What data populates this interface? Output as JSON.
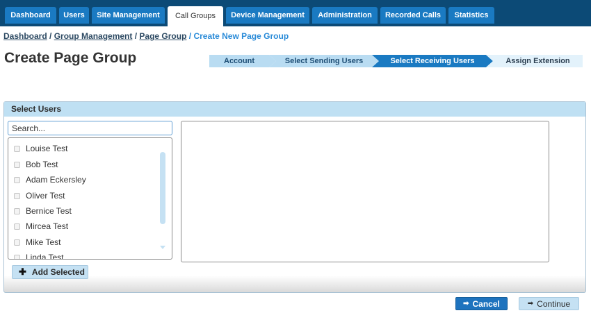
{
  "nav": {
    "tabs": [
      {
        "label": "Dashboard",
        "active": false
      },
      {
        "label": "Users",
        "active": false
      },
      {
        "label": "Site Management",
        "active": false
      },
      {
        "label": "Call Groups",
        "active": true
      },
      {
        "label": "Device Management",
        "active": false
      },
      {
        "label": "Administration",
        "active": false
      },
      {
        "label": "Recorded Calls",
        "active": false
      },
      {
        "label": "Statistics",
        "active": false
      }
    ]
  },
  "breadcrumb": {
    "items": [
      "Dashboard",
      "Group Management",
      "Page Group"
    ],
    "separator": " / ",
    "current": "Create New Page Group"
  },
  "page": {
    "title": "Create Page Group"
  },
  "wizard": {
    "steps": [
      {
        "label": "Account",
        "state": "done"
      },
      {
        "label": "Select Sending Users",
        "state": "done"
      },
      {
        "label": "Select Receiving Users",
        "state": "active"
      },
      {
        "label": "Assign Extension",
        "state": "pending"
      }
    ],
    "colors": {
      "done": "#b9dcf2",
      "active": "#1a7ac2",
      "pending": "#e3f2fb"
    }
  },
  "select_users": {
    "header": "Select Users",
    "search_placeholder": "Search...",
    "users": [
      {
        "name": "Louise Test",
        "checked": false
      },
      {
        "name": "Bob Test",
        "checked": false
      },
      {
        "name": "Adam Eckersley",
        "checked": false
      },
      {
        "name": "Oliver Test",
        "checked": false
      },
      {
        "name": "Bernice Test",
        "checked": false
      },
      {
        "name": "Mircea Test",
        "checked": false
      },
      {
        "name": "Mike Test",
        "checked": false
      },
      {
        "name": "Linda Test",
        "checked": false
      }
    ],
    "add_button": "Add Selected",
    "add_icon": "plus-icon"
  },
  "actions": {
    "cancel": "Cancel",
    "cancel_icon": "arrow-right-icon",
    "continue": "Continue",
    "continue_icon": "arrow-right-icon"
  },
  "colors": {
    "nav_bg": "#0c4a76",
    "tab_bg": "#1a7ac2",
    "accent": "#1e73be",
    "panel_header": "#bfe0f3",
    "breadcrumb_current": "#2a8bd8"
  }
}
